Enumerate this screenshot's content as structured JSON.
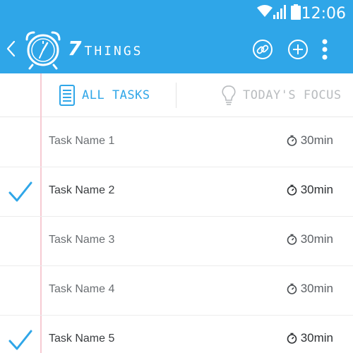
{
  "status_bar": {
    "time": "12:06"
  },
  "app_bar": {
    "brand_number": "7",
    "brand_word": "THINGS"
  },
  "tabs": [
    {
      "label": "ALL TASKS",
      "active": true
    },
    {
      "label": "TODAY'S FOCUS",
      "active": false
    }
  ],
  "tasks": [
    {
      "name": "Task Name 1",
      "duration": "30min",
      "done": false
    },
    {
      "name": "Task Name 2",
      "duration": "30min",
      "done": true
    },
    {
      "name": "Task Name 3",
      "duration": "30min",
      "done": false
    },
    {
      "name": "Task Name 4",
      "duration": "30min",
      "done": false
    },
    {
      "name": "Task Name 5",
      "duration": "30min",
      "done": true
    }
  ],
  "colors": {
    "primary": "#2fa6e8",
    "margin_line": "#f6cbd3",
    "muted": "#b9bcbf"
  },
  "icons": {
    "back": "chevron-left-icon",
    "logo": "alarm-clock-icon",
    "link": "link-icon",
    "add": "plus-circle-icon",
    "more": "more-vertical-icon",
    "all_tasks": "document-list-icon",
    "focus": "lightbulb-icon",
    "timer": "stopwatch-icon",
    "check": "checkmark-icon"
  }
}
